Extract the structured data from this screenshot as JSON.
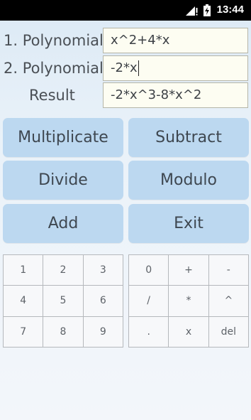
{
  "status_bar": {
    "time": "13:44",
    "signal_icon": "signal-icon",
    "battery_icon": "battery-charging-icon"
  },
  "form": {
    "poly1_label": "1. Polynomial",
    "poly1_value": "x^2+4*x",
    "poly2_label": "2. Polynomial",
    "poly2_value": "-2*x",
    "result_label": "Result",
    "result_value": "-2*x^3-8*x^2"
  },
  "buttons": {
    "multiplicate": "Multiplicate",
    "subtract": "Subtract",
    "divide": "Divide",
    "modulo": "Modulo",
    "add": "Add",
    "exit": "Exit"
  },
  "keypad_left": [
    "1",
    "2",
    "3",
    "4",
    "5",
    "6",
    "7",
    "8",
    "9"
  ],
  "keypad_right": [
    "0",
    "+",
    "-",
    "/",
    "*",
    "^",
    ".",
    "x",
    "del"
  ],
  "colors": {
    "button_bg": "#bcd8f0",
    "field_bg": "#fdfdf2",
    "status_bar_bg": "#000000"
  }
}
